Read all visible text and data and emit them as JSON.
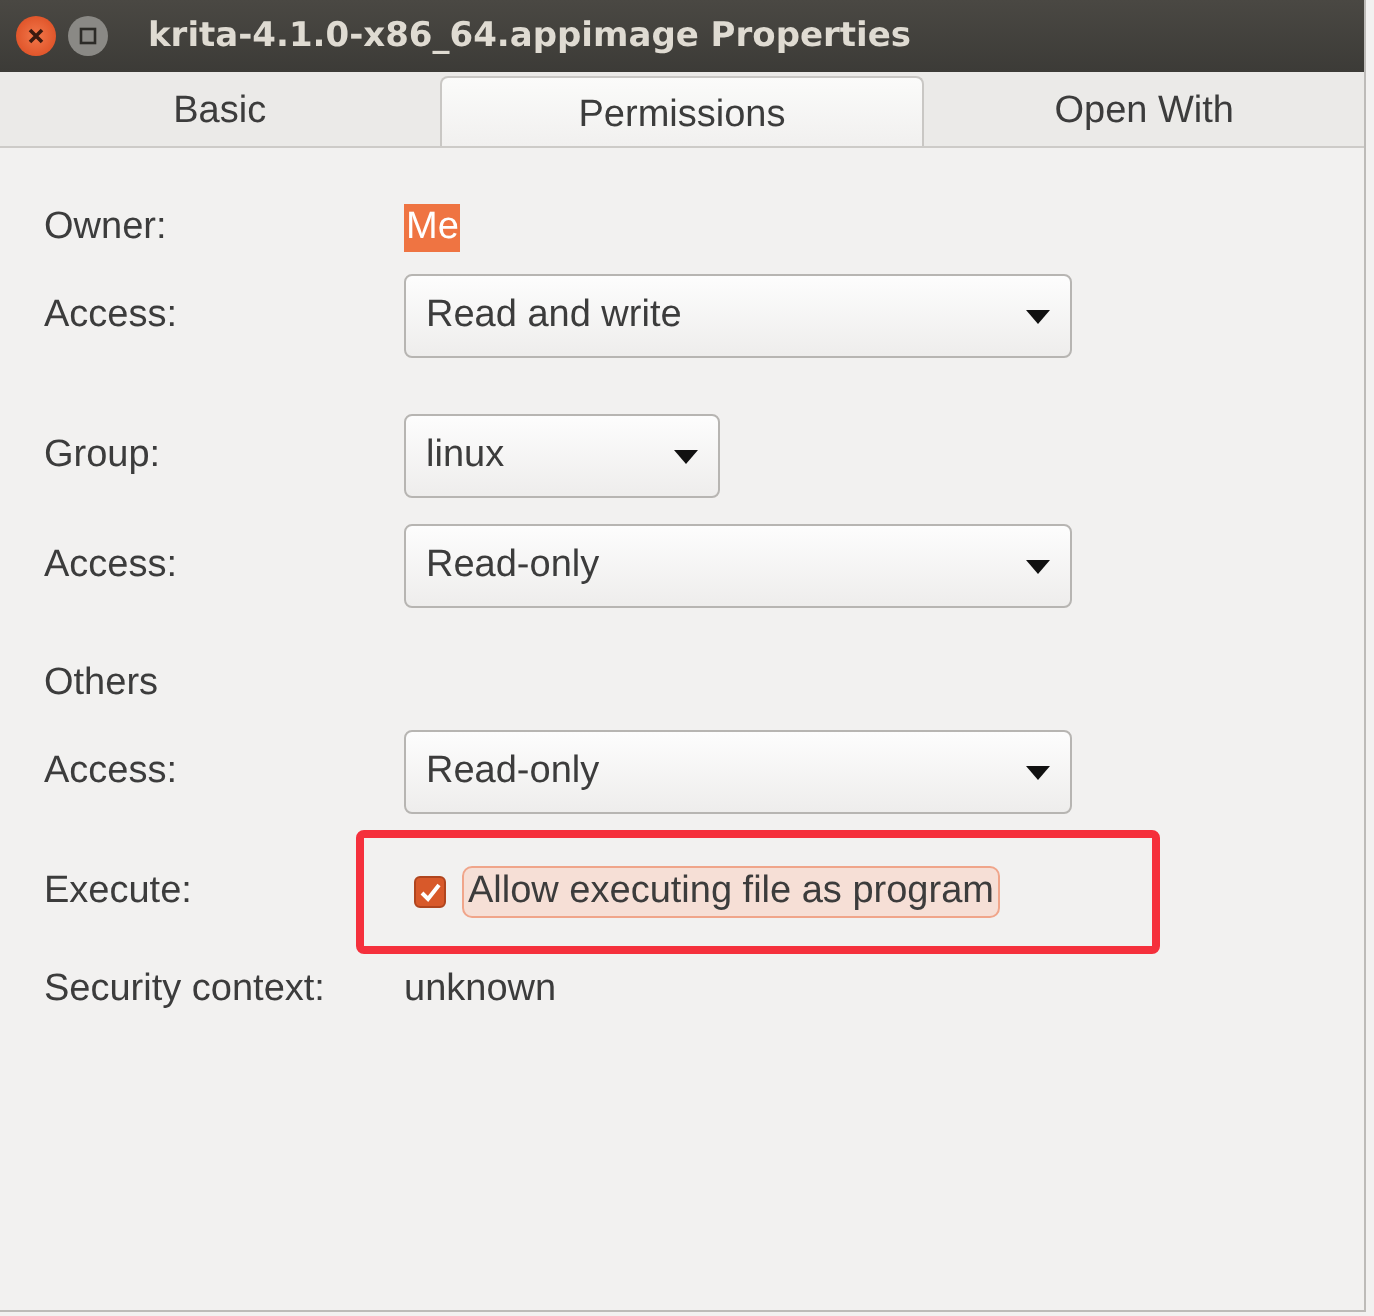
{
  "window": {
    "title": "krita-4.1.0-x86_64.appimage Properties"
  },
  "tabs": [
    {
      "label": "Basic",
      "selected": false
    },
    {
      "label": "Permissions",
      "selected": true
    },
    {
      "label": "Open With",
      "selected": false
    }
  ],
  "owner": {
    "label": "Owner:",
    "value": "Me",
    "selected": true
  },
  "rows": [
    {
      "kind": "dropdown",
      "label": "Access:",
      "value": "Read and write",
      "wide": true
    },
    {
      "kind": "dropdown",
      "label": "Group:",
      "value": "linux",
      "wide": false
    },
    {
      "kind": "dropdown",
      "label": "Access:",
      "value": "Read-only",
      "wide": true
    },
    {
      "kind": "heading",
      "label": "Others"
    },
    {
      "kind": "dropdown",
      "label": "Access:",
      "value": "Read-only",
      "wide": true
    }
  ],
  "execute": {
    "label": "Execute:",
    "option": "Allow executing file as program",
    "checked": true,
    "highlighted": true
  },
  "security": {
    "label": "Security context:",
    "value": "unknown"
  }
}
